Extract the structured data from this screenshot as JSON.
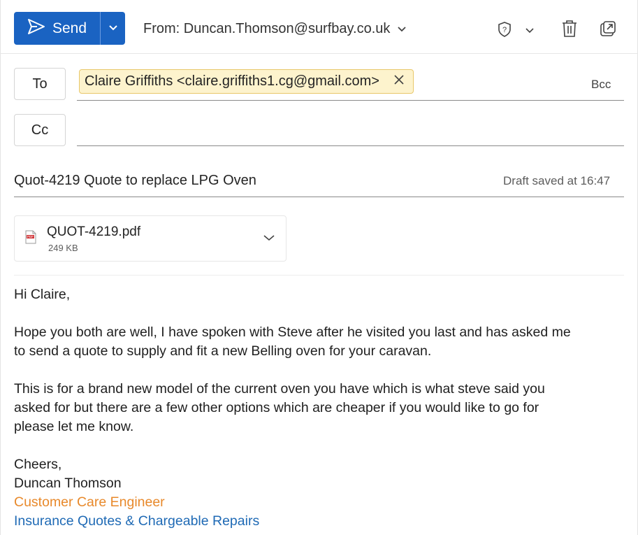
{
  "toolbar": {
    "send_label": "Send",
    "from_label": "From: Duncan.Thomson@surfbay.co.uk",
    "icons": [
      "send-icon",
      "chevron-down-icon",
      "shield-icon",
      "chevron-down-icon",
      "trash-icon",
      "popout-icon"
    ],
    "accent_color": "#1a63c2"
  },
  "recipients": {
    "to_label": "To",
    "cc_label": "Cc",
    "bcc_label": "Bcc",
    "to_chip": "Claire Griffiths <claire.griffiths1.cg@gmail.com>"
  },
  "subject": {
    "value": "Quot-4219 Quote to replace LPG Oven",
    "draft_status": "Draft saved at 16:47"
  },
  "attachment": {
    "name": "QUOT-4219.pdf",
    "size": "249 KB"
  },
  "body": {
    "greeting": "Hi Claire,",
    "para1_line1": "Hope you both are well, I have spoken with Steve after he visited you last and has asked me",
    "para1_line2": "to send a quote to supply and fit a new Belling oven for your caravan.",
    "para2_line1": "This is for a brand new model of the current oven you have which is what steve said you",
    "para2_line2": "asked for but there are a few other options which are cheaper if you would like to go for",
    "para2_line3": "please let me know.",
    "signoff": "Cheers,",
    "sig_name": "Duncan Thomson",
    "sig_title": "Customer Care Engineer",
    "sig_dept": "Insurance Quotes & Chargeable Repairs",
    "sig_title_color": "#e8892b",
    "sig_dept_color": "#1f6ab5"
  }
}
